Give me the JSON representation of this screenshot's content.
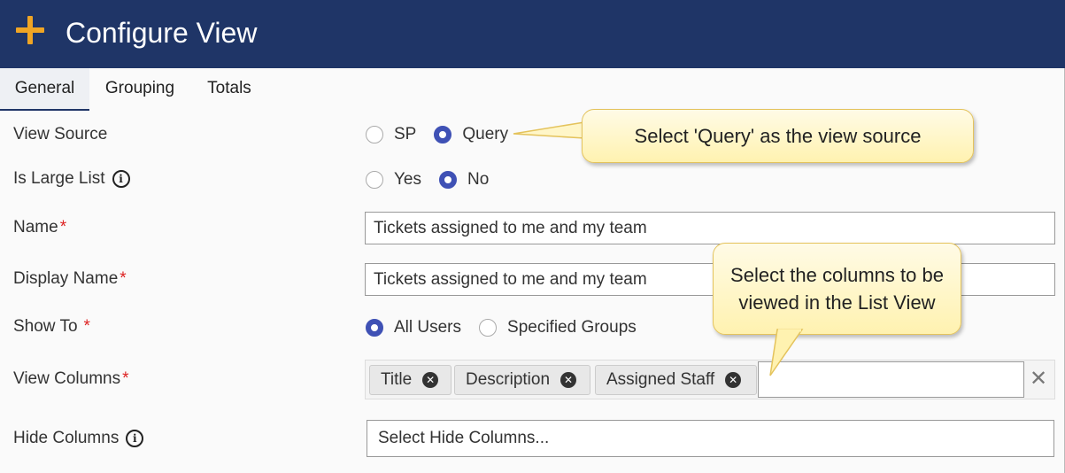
{
  "header": {
    "title": "Configure View",
    "icon": "plus-icon",
    "background": "#1f3567",
    "accent": "#f0a524"
  },
  "tabs": [
    {
      "label": "General",
      "active": true
    },
    {
      "label": "Grouping",
      "active": false
    },
    {
      "label": "Totals",
      "active": false
    }
  ],
  "form": {
    "view_source": {
      "label": "View Source",
      "options": [
        "SP",
        "Query"
      ],
      "selected": "Query"
    },
    "is_large_list": {
      "label": "Is Large List",
      "options": [
        "Yes",
        "No"
      ],
      "selected": "No"
    },
    "name": {
      "label": "Name",
      "required": "*",
      "value": "Tickets assigned to me and my team"
    },
    "display_name": {
      "label": "Display Name",
      "required": "*",
      "value": "Tickets assigned to me and my team"
    },
    "show_to": {
      "label": "Show To",
      "required": "*",
      "options": [
        "All Users",
        "Specified Groups"
      ],
      "selected": "All Users"
    },
    "view_columns": {
      "label": "View Columns",
      "required": "*",
      "chips": [
        "Title",
        "Description",
        "Assigned Staff"
      ],
      "clear": "✕"
    },
    "hide_columns": {
      "label": "Hide Columns",
      "placeholder": "Select Hide Columns..."
    }
  },
  "callouts": {
    "query_hint": "Select 'Query' as the view source",
    "columns_hint": "Select the columns to be viewed in the List View"
  },
  "colors": {
    "radio_selected": "#3f51b5",
    "required_mark": "#dd2222",
    "callout_fill": "#fff2b0"
  }
}
